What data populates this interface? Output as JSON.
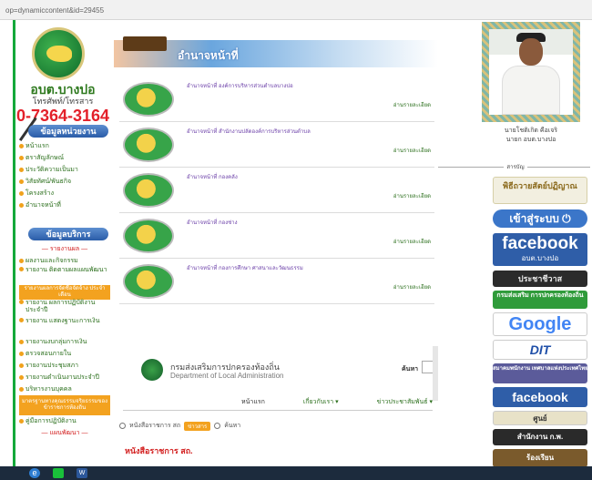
{
  "browser": {
    "url": "op=dynamiccontent&id=29455"
  },
  "sidebar": {
    "site_name": "อบต.บางปอ",
    "site_sub": "โทรศัพท์/โทรสาร",
    "phone": "0-7364-3164",
    "section1": "ข้อมูลหน่วยงาน",
    "section2": "ข้อมูลบริการ",
    "items1": [
      "หน้าแรก",
      "ตราสัญลักษณ์",
      "ประวัติความเป็นมา",
      "วิสัยทัศน์/พันธกิจ",
      "โครงสร้าง",
      "อำนาจหน้าที่"
    ],
    "report_header": "— รายงานผล —",
    "items2": [
      "ผลงานและกิจกรรม",
      "รายงาน ติดตามผลแผนพัฒนา"
    ],
    "orange1": "รายงานผลการจัดซื้อจัดจ้าง ประจำเดือน",
    "items3": [
      "รายงาน ผลการปฏิบัติงานประจำปี",
      "รายงาน แสดงฐานะการเงิน",
      "รายงานงบกลุ่มการเงิน",
      "ตรวจสอบภายใน",
      "รายงานประชุมสภา",
      "รายงานดำเนินงานประจำปี",
      "บริหารงานบุคคล"
    ],
    "orange2": "มาตรฐานทางคุณธรรมจริยธรรมของข้าราชการท้องถิ่น",
    "items4": [
      "คู่มือการปฏิบัติงาน"
    ],
    "plan_header": "— แผนพัฒนา —"
  },
  "main": {
    "banner_title": "อำนาจหน้าที่",
    "rows": [
      {
        "title": "อำนาจหน้าที่ องค์การบริหารส่วนตำบลบางปอ",
        "more": "อ่านรายละเอียด"
      },
      {
        "title": "อำนาจหน้าที่ สำนักงานปลัดองค์การบริหารส่วนตำบล",
        "more": "อ่านรายละเอียด"
      },
      {
        "title": "อำนาจหน้าที่ กองคลัง",
        "more": "อ่านรายละเอียด"
      },
      {
        "title": "อำนาจหน้าที่ กองช่าง",
        "more": "อ่านรายละเอียด"
      },
      {
        "title": "อำนาจหน้าที่ กองการศึกษา ศาสนาและวัฒนธรรม",
        "more": "อ่านรายละเอียด"
      }
    ],
    "dla_th": "กรมส่งเสริมการปกครองท้องถิ่น",
    "dla_en": "Department of Local Administration",
    "dla_search": "ค้นหา",
    "nav": [
      "หน้าแรก",
      "เกี่ยวกับเรา ▾",
      "ข่าวประชาสัมพันธ์ ▾"
    ],
    "radio1": "หนังสือราชการ สถ",
    "radio_btn": "ข่าวสาร",
    "radio2": "ค้นหา",
    "doc_title": "หนังสือราชการ สถ."
  },
  "right": {
    "person_name": "นายโชติเกิด คือเจริ",
    "person_pos": "นายก อบต.บางปอ",
    "links_head": "สารบัญ",
    "buttons": [
      "พิธีถวายสัตย์ปฏิญาณ",
      "เข้าสู่ระบบ",
      "facebook",
      "ประชาชีวาส",
      "กรมส่งเสริม การปกครองท้องถิ่น",
      "Google",
      "DIT",
      "สมาคมพนักงาน เทศบาลแห่งประเทศไทย",
      "facebook",
      "ศูนย์",
      "สำนักงาน ก.พ.",
      "ร้องเรียน"
    ],
    "fb_sub": "อบต.บางปอ"
  }
}
